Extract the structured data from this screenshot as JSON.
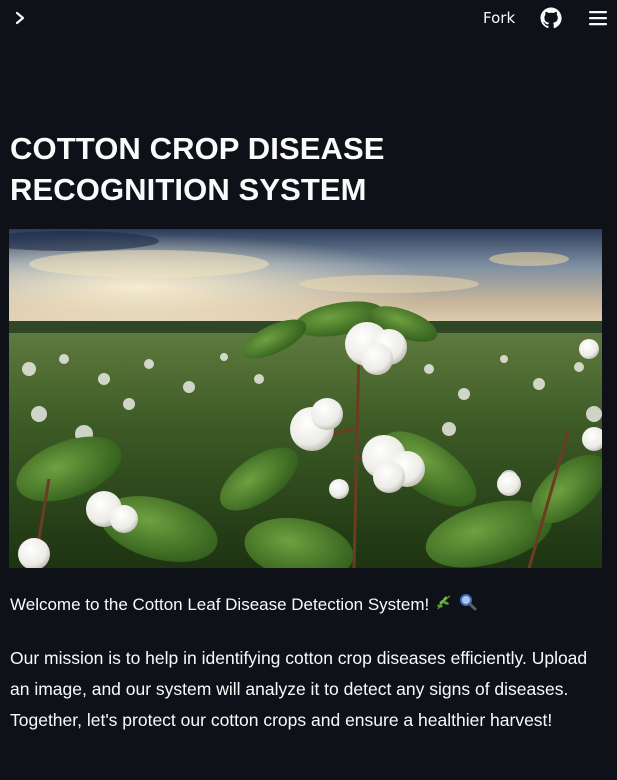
{
  "header": {
    "fork_label": "Fork"
  },
  "main": {
    "title": "COTTON CROP DISEASE RECOGNITION SYSTEM",
    "welcome_text": "Welcome to the Cotton Leaf Disease Detection System!",
    "mission_text": "Our mission is to help in identifying cotton crop diseases efficiently. Upload an image, and our system will analyze it to detect any signs of diseases. Together, let's protect our cotton crops and ensure a healthier harvest!"
  },
  "icons": {
    "sidebar_toggle": "chevron-right-icon",
    "github": "github-icon",
    "menu": "hamburger-menu-icon",
    "welcome_emoji_1": "herb-icon",
    "welcome_emoji_2": "magnifying-glass-icon"
  },
  "colors": {
    "background": "#0e1117",
    "text": "#fafafa"
  }
}
